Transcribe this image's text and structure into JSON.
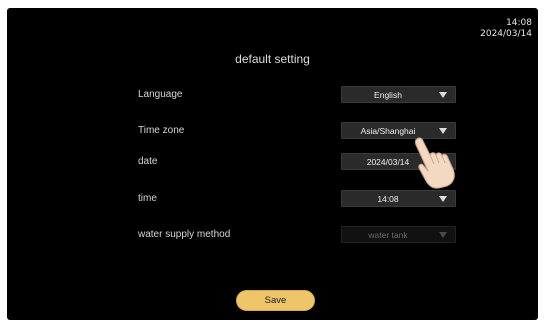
{
  "status": {
    "time": "14:08",
    "date": "2024/03/14"
  },
  "page": {
    "title": "default setting"
  },
  "settings": [
    {
      "label": "Language",
      "value": "English"
    },
    {
      "label": "Time zone",
      "value": "Asia/Shanghai"
    },
    {
      "label": "date",
      "value": "2024/03/14"
    },
    {
      "label": "time",
      "value": "14:08"
    },
    {
      "label": "water supply method",
      "value": "water tank"
    }
  ],
  "actions": {
    "save_label": "Save"
  },
  "icons": {
    "dropdown": "chevron-down-icon",
    "pointer": "hand-pointer-icon"
  },
  "colors": {
    "background": "#000000",
    "save_button": "#efc56a",
    "control_bg": "#2a2a2a"
  }
}
